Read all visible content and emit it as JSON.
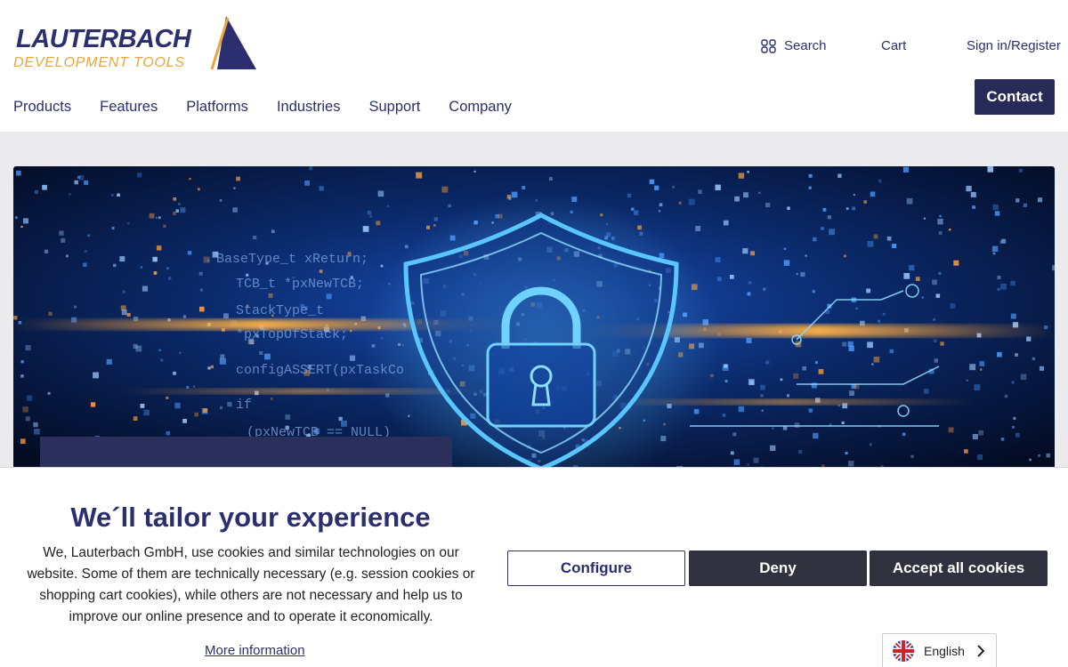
{
  "brand": {
    "name": "LAUTERBACH",
    "tagline": "DEVELOPMENT TOOLS",
    "colors": {
      "navy": "#2b2f6f",
      "gold": "#e9a63a"
    }
  },
  "utility_nav": {
    "search_label": "Search",
    "cart_label": "Cart",
    "signin_label": "Sign in/Register"
  },
  "main_nav": {
    "items": [
      {
        "label": "Products"
      },
      {
        "label": "Features"
      },
      {
        "label": "Platforms"
      },
      {
        "label": "Industries"
      },
      {
        "label": "Support"
      },
      {
        "label": "Company"
      }
    ]
  },
  "contact_button": {
    "label": "Contact"
  },
  "hero": {
    "code_lines": [
      "BaseType_t xReturn;",
      "TCB_t *pxNewTCB;",
      "StackType_t",
      "*pxTopOfStack;",
      "configASSERT(pxTaskCo",
      "if",
      "(pxNewTCB == NULL)"
    ]
  },
  "cookie_banner": {
    "title": "We´ll tailor your experience",
    "text": "We, Lauterbach GmbH, use cookies and similar technologies on our website. Some of them are technically necessary (e.g. session cookies or shopping cart cookies), while others are not necessary and help us to improve our online presence and to operate it economically.",
    "more_info": "More information",
    "buttons": {
      "configure": "Configure",
      "deny": "Deny",
      "accept": "Accept all cookies"
    }
  },
  "language": {
    "label": "English"
  }
}
